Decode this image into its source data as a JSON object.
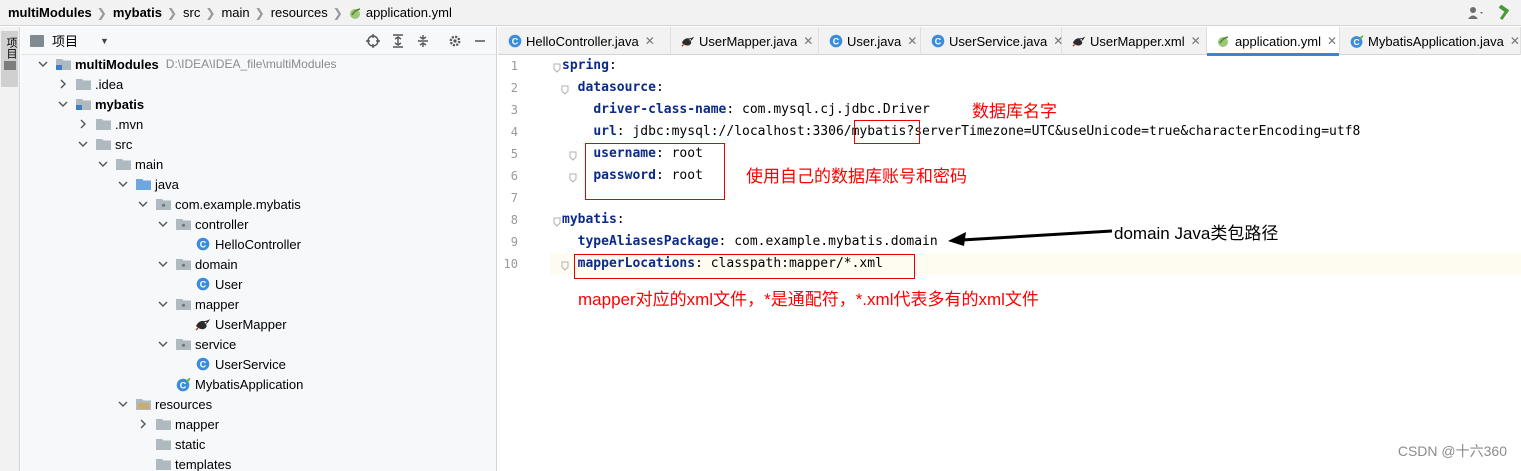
{
  "breadcrumb": [
    {
      "label": "multiModules",
      "bold": true
    },
    {
      "label": "mybatis",
      "bold": true
    },
    {
      "label": "src",
      "bold": false
    },
    {
      "label": "main",
      "bold": false
    },
    {
      "label": "resources",
      "bold": false
    },
    {
      "label": "application.yml",
      "bold": false,
      "icon": "spring-yml-icon"
    }
  ],
  "tool_stripe": {
    "tab_label": "项目"
  },
  "project_panel": {
    "title": "项目",
    "tree": [
      {
        "label": "multiModules",
        "path": "D:\\IDEA\\IDEA_file\\multiModules",
        "bold": true,
        "depth": 0,
        "expanded": true,
        "icon": "module-folder-icon"
      },
      {
        "label": ".idea",
        "depth": 1,
        "expanded": false,
        "icon": "folder-icon"
      },
      {
        "label": "mybatis",
        "bold": true,
        "depth": 1,
        "expanded": true,
        "icon": "module-folder-icon"
      },
      {
        "label": ".mvn",
        "depth": 2,
        "expanded": false,
        "icon": "folder-icon"
      },
      {
        "label": "src",
        "depth": 2,
        "expanded": true,
        "icon": "folder-icon"
      },
      {
        "label": "main",
        "depth": 3,
        "expanded": true,
        "icon": "folder-icon"
      },
      {
        "label": "java",
        "depth": 4,
        "expanded": true,
        "icon": "source-folder-icon"
      },
      {
        "label": "com.example.mybatis",
        "depth": 5,
        "expanded": true,
        "icon": "package-icon"
      },
      {
        "label": "controller",
        "depth": 6,
        "expanded": true,
        "icon": "package-icon"
      },
      {
        "label": "HelloController",
        "depth": 7,
        "icon": "class-icon"
      },
      {
        "label": "domain",
        "depth": 6,
        "expanded": true,
        "icon": "package-icon"
      },
      {
        "label": "User",
        "depth": 7,
        "icon": "class-icon"
      },
      {
        "label": "mapper",
        "depth": 6,
        "expanded": true,
        "icon": "package-icon"
      },
      {
        "label": "UserMapper",
        "depth": 7,
        "icon": "mybatis-bird-icon"
      },
      {
        "label": "service",
        "depth": 6,
        "expanded": true,
        "icon": "package-icon"
      },
      {
        "label": "UserService",
        "depth": 7,
        "icon": "class-icon"
      },
      {
        "label": "MybatisApplication",
        "depth": 6,
        "icon": "spring-class-icon"
      },
      {
        "label": "resources",
        "depth": 4,
        "expanded": true,
        "icon": "resources-folder-icon"
      },
      {
        "label": "mapper",
        "depth": 5,
        "expanded": false,
        "icon": "folder-icon"
      },
      {
        "label": "static",
        "depth": 5,
        "icon": "folder-icon"
      },
      {
        "label": "templates",
        "depth": 5,
        "icon": "folder-icon"
      }
    ]
  },
  "tabs": [
    {
      "label": "HelloController.java",
      "icon": "class-icon",
      "active": false
    },
    {
      "label": "UserMapper.java",
      "icon": "mybatis-bird-icon",
      "active": false
    },
    {
      "label": "User.java",
      "icon": "class-icon",
      "active": false
    },
    {
      "label": "UserService.java",
      "icon": "class-icon",
      "active": false
    },
    {
      "label": "UserMapper.xml",
      "icon": "mybatis-bird-icon",
      "active": false
    },
    {
      "label": "application.yml",
      "icon": "spring-yml-icon",
      "active": true
    },
    {
      "label": "MybatisApplication.java",
      "icon": "spring-class-icon",
      "active": false
    }
  ],
  "editor": {
    "lines": [
      {
        "n": "1",
        "indent": 0,
        "key": "spring",
        "value": ""
      },
      {
        "n": "2",
        "indent": 2,
        "key": "datasource",
        "value": ""
      },
      {
        "n": "3",
        "indent": 4,
        "key": "driver-class-name",
        "value": "com.mysql.cj.jdbc.Driver"
      },
      {
        "n": "4",
        "indent": 4,
        "key": "url",
        "value": "jdbc:mysql://localhost:3306/mybatis?serverTimezone=UTC&useUnicode=true&characterEncoding=utf8"
      },
      {
        "n": "5",
        "indent": 4,
        "key": "username",
        "value": "root"
      },
      {
        "n": "6",
        "indent": 4,
        "key": "password",
        "value": "root"
      },
      {
        "n": "7",
        "indent": 0,
        "key": "",
        "value": ""
      },
      {
        "n": "8",
        "indent": 0,
        "key": "mybatis",
        "value": ""
      },
      {
        "n": "9",
        "indent": 2,
        "key": "typeAliasesPackage",
        "value": "com.example.mybatis.domain"
      },
      {
        "n": "10",
        "indent": 2,
        "key": "mapperLocations",
        "value": "classpath:mapper/*.xml"
      }
    ],
    "current_line": "10"
  },
  "annotations": {
    "db_name": "数据库名字",
    "account": "使用自己的数据库账号和密码",
    "domain": "domain Java类包路径",
    "mapper": "mapper对应的xml文件，*是通配符，*.xml代表多有的xml文件"
  },
  "watermark": "CSDN @十六360",
  "colors": {
    "annotation": "#ff0000",
    "keyword": "#0b2a8a",
    "active_tab_underline": "#4083c9",
    "current_line": "#fefcf0"
  }
}
